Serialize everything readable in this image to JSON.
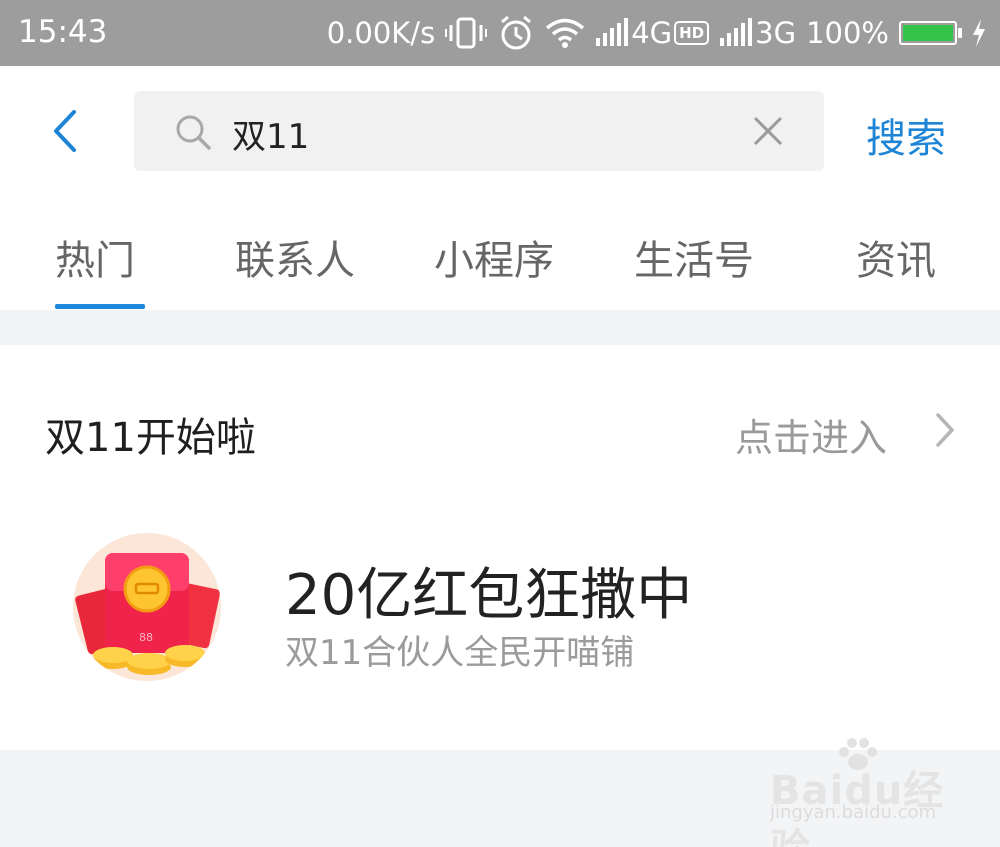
{
  "status_bar": {
    "time": "15:43",
    "net_speed": "0.00K/s",
    "network_1": "4G",
    "hd_badge": "HD",
    "network_2": "3G",
    "battery": "100%",
    "battery_level": 1.0,
    "icons": [
      "vibrate-icon",
      "alarm-icon",
      "wifi-icon",
      "signal-icon",
      "hd-icon",
      "signal-icon",
      "battery-icon",
      "charging-icon"
    ]
  },
  "search": {
    "query": "双11",
    "action_label": "搜索"
  },
  "tabs": [
    {
      "label": "热门",
      "active": true
    },
    {
      "label": "联系人",
      "active": false
    },
    {
      "label": "小程序",
      "active": false
    },
    {
      "label": "生活号",
      "active": false
    },
    {
      "label": "资讯",
      "active": false
    }
  ],
  "card": {
    "title": "双11开始啦",
    "more_label": "点击进入",
    "item": {
      "title": "20亿红包狂撒中",
      "subtitle": "双11合伙人全民开喵铺"
    }
  },
  "watermark": {
    "brand": "Baidu经验",
    "url": "jingyan.baidu.com"
  },
  "colors": {
    "accent": "#1e88dc",
    "status_bar": "#9d9d9d",
    "battery": "#35c44a"
  }
}
